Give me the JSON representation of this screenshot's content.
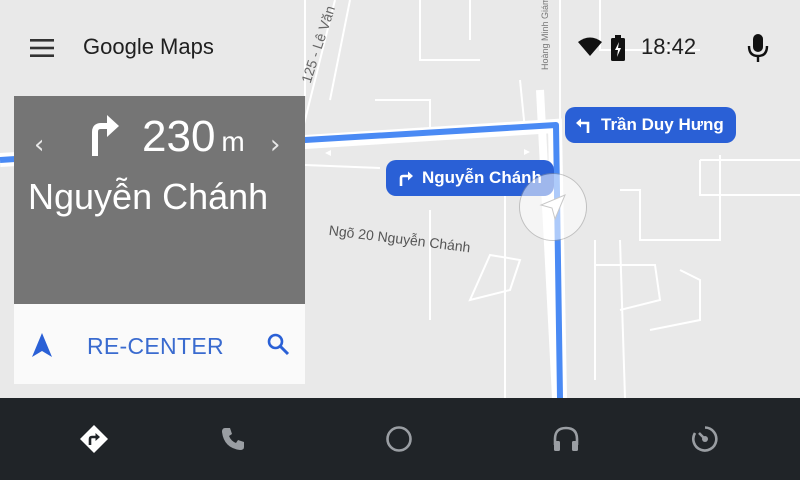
{
  "app_title": "Google Maps",
  "status": {
    "time": "18:42",
    "wifi_icon": "wifi-icon",
    "battery_icon": "battery-charging-icon"
  },
  "map": {
    "labels": {
      "road_125": "125 - Lê Văn",
      "hoang_minh_giam": "Hoàng Minh Giám",
      "ngo_20": "Ngõ 20 Nguyễn Chánh"
    },
    "callouts": [
      {
        "text": "Trần Duy Hưng",
        "icon": "turn-left-icon"
      },
      {
        "text": "Nguyễn Chánh",
        "icon": "turn-right-icon"
      }
    ],
    "route_color": "#4a8af4"
  },
  "nav_card": {
    "distance_value": "230",
    "distance_unit": "m",
    "street": "Nguyễn Chánh",
    "maneuver_icon": "turn-right-icon",
    "recenter_label": "RE-CENTER"
  },
  "bottom_nav": [
    {
      "name": "navigation",
      "icon": "directions-icon",
      "active": true
    },
    {
      "name": "phone",
      "icon": "phone-icon",
      "active": false
    },
    {
      "name": "home",
      "icon": "home-circle-icon",
      "active": false
    },
    {
      "name": "music",
      "icon": "headphones-icon",
      "active": false
    },
    {
      "name": "overview",
      "icon": "speedometer-icon",
      "active": false
    }
  ],
  "colors": {
    "accent": "#2a60d6",
    "nav_card_bg": "#757575",
    "bottom_bar_bg": "#202428"
  }
}
